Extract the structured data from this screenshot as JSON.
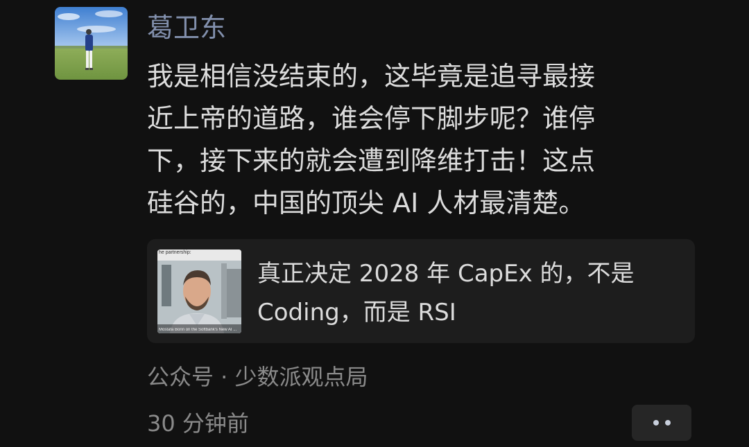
{
  "post": {
    "author": "葛卫东",
    "text": "我是相信没结束的，这毕竟是追寻最接\n近上帝的道路，谁会停下脚步呢？谁停\n下，接下来的就会遭到降维打击！这点\n硅谷的，中国的顶尖 AI 人材最清楚。",
    "link_card": {
      "thumb_caption": "he partnership:",
      "thumb_subtitle": "Mostafa Bonn on the Softbank's New AI ...",
      "title": "真正决定 2028 年 CapEx 的，不是\nCoding，而是 RSI"
    },
    "source": "公众号 · 少数派观点局",
    "time": "30 分钟前",
    "more_icon": "more-dots-icon"
  },
  "colors": {
    "background": "#111111",
    "author": "#8290ad",
    "text": "#dcdcdc",
    "meta": "#8a8a8a",
    "card": "#1d1d1d"
  }
}
